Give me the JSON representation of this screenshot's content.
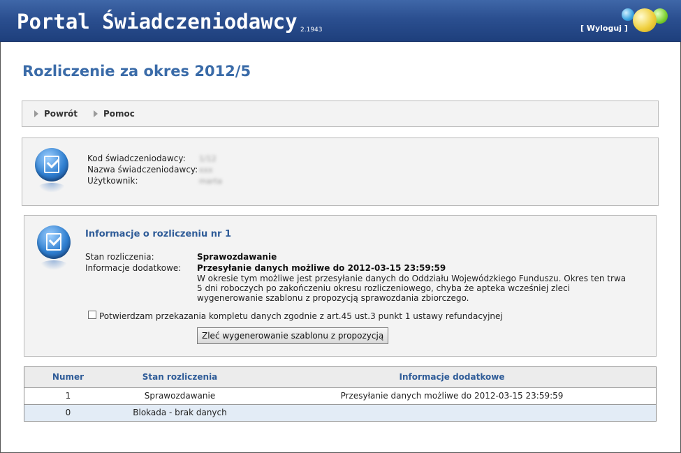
{
  "header": {
    "title": "Portal Świadczeniodawcy",
    "version": "2.1943",
    "logout_label": "[ Wyloguj ]"
  },
  "page_title": "Rozliczenie za okres 2012/5",
  "nav": {
    "back_label": "Powrót",
    "help_label": "Pomoc"
  },
  "provider": {
    "code_label": "Kod świadczeniodawcy:",
    "code_value": "1/12",
    "name_label": "Nazwa świadczeniodawcy:",
    "name_value": "xxx",
    "user_label": "Użytkownik:",
    "user_value": "marta"
  },
  "settlement": {
    "title": "Informacje o rozliczeniu nr 1",
    "status_label": "Stan rozliczenia:",
    "status_value": "Sprawozdawanie",
    "extra_label": "Informacje dodatkowe:",
    "extra_value": "Przesyłanie danych możliwe do 2012-03-15 23:59:59",
    "description": "W okresie tym możliwe jest przesyłanie danych do Oddziału Wojewódzkiego Funduszu. Okres ten trwa 5 dni roboczych po zakończeniu okresu rozliczeniowego, chyba że apteka wcześniej zleci wygenerowanie szablonu z propozycją sprawozdania zbiorczego.",
    "confirm_label": "Potwierdzam przekazania kompletu danych zgodnie z art.45 ust.3 punkt 1 ustawy refundacyjnej",
    "generate_button": "Zleć wygenerowanie szablonu z propozycją"
  },
  "table": {
    "headers": [
      "Numer",
      "Stan rozliczenia",
      "Informacje dodatkowe"
    ],
    "rows": [
      [
        "1",
        "Sprawozdawanie",
        "Przesyłanie danych możliwe do 2012-03-15 23:59:59"
      ],
      [
        "0",
        "Blokada - brak danych",
        ""
      ]
    ]
  },
  "colors": {
    "header_bg": "#2b4f90",
    "accent": "#3a6ba8",
    "row_alt": "#e3ecf6"
  }
}
